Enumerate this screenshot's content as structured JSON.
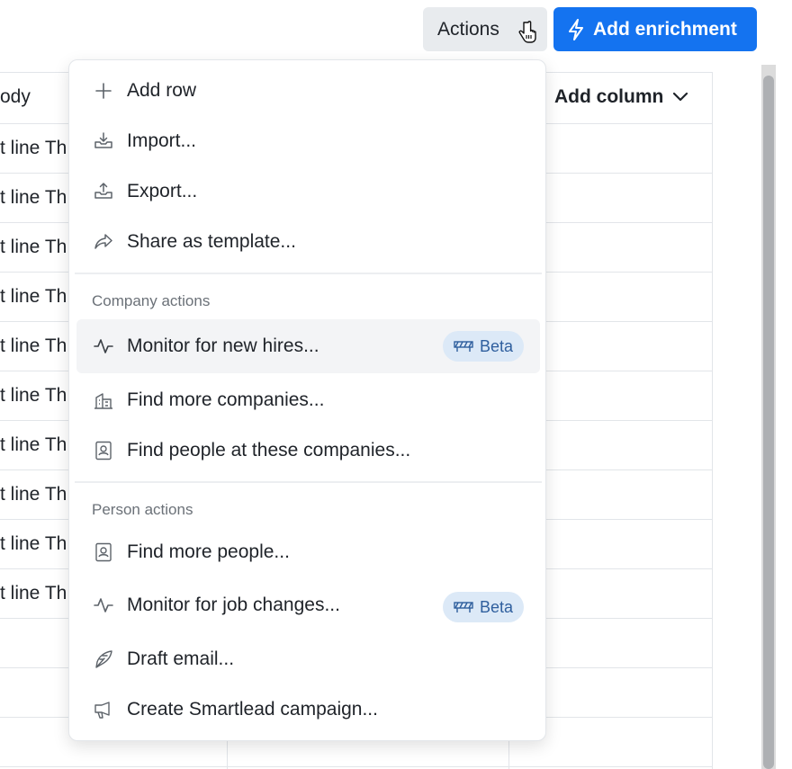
{
  "toolbar": {
    "actions_label": "Actions",
    "add_enrichment_label": "Add enrichment",
    "accent": "#1473f0"
  },
  "table": {
    "body_header": "ody",
    "add_column_label": "Add column",
    "rows": [
      "t line Th",
      "t line Th",
      "t line Th",
      "t line Th",
      "t line Th",
      "t line Th",
      "t line Th",
      "t line Th",
      "t line Th",
      "t line Th"
    ]
  },
  "menu": {
    "general": [
      {
        "label": "Add row",
        "icon": "plus-icon"
      },
      {
        "label": "Import...",
        "icon": "import-icon"
      },
      {
        "label": "Export...",
        "icon": "export-icon"
      },
      {
        "label": "Share as template...",
        "icon": "share-icon"
      }
    ],
    "company_section": "Company actions",
    "company": [
      {
        "label": "Monitor for new hires...",
        "icon": "activity-icon",
        "badge": "Beta"
      },
      {
        "label": "Find more companies...",
        "icon": "buildings-icon"
      },
      {
        "label": "Find people at these companies...",
        "icon": "contact-card-icon"
      }
    ],
    "person_section": "Person actions",
    "person": [
      {
        "label": "Find more people...",
        "icon": "contact-card-icon"
      },
      {
        "label": "Monitor for job changes...",
        "icon": "activity-icon",
        "badge": "Beta"
      },
      {
        "label": "Draft email...",
        "icon": "quill-icon"
      },
      {
        "label": "Create Smartlead campaign...",
        "icon": "megaphone-icon"
      }
    ]
  }
}
